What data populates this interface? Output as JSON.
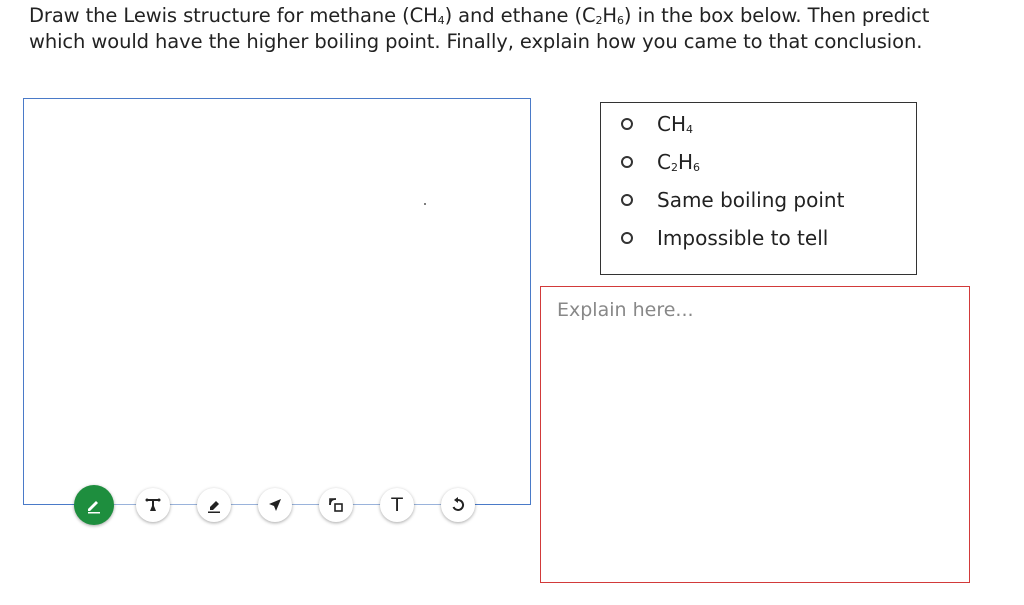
{
  "prompt": {
    "part1": "Draw the Lewis structure for methane (CH",
    "sub1": "4",
    "part2": ") and ethane (C",
    "sub2": "2",
    "part3": "H",
    "sub3": "6",
    "part4": ") in the box below. Then predict which would have the higher boiling point. Finally, explain how you came to that conclusion."
  },
  "toolbar": {
    "tools": [
      {
        "name": "pencil-icon"
      },
      {
        "name": "line-tool-icon"
      },
      {
        "name": "eraser-icon"
      },
      {
        "name": "pointer-arrow-icon"
      },
      {
        "name": "shapes-icon"
      },
      {
        "name": "text-tool-icon",
        "glyph": "T"
      },
      {
        "name": "undo-icon"
      }
    ],
    "accent": "#1e8e3e"
  },
  "choices": {
    "options": [
      {
        "main": "CH",
        "sub": "4",
        "after": ""
      },
      {
        "main": "C",
        "sub": "2",
        "after": "H",
        "sub2": "6"
      },
      {
        "main": "Same boiling point"
      },
      {
        "main": "Impossible to tell"
      }
    ]
  },
  "explain": {
    "placeholder": "Explain here...",
    "value": ""
  },
  "colors": {
    "draw_border": "#4a7ac8",
    "explain_border": "#d23a3a"
  }
}
